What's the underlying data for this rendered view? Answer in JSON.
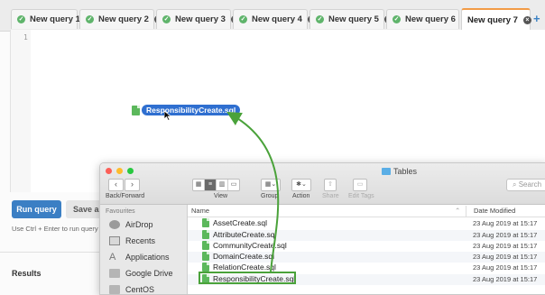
{
  "tabs": [
    {
      "label": "New query 1",
      "status": "check",
      "closable": false,
      "active": false
    },
    {
      "label": "New query 2",
      "status": "check",
      "closable": true,
      "active": false
    },
    {
      "label": "New query 3",
      "status": "check",
      "closable": true,
      "active": false
    },
    {
      "label": "New query 4",
      "status": "check",
      "closable": true,
      "active": false
    },
    {
      "label": "New query 5",
      "status": "check",
      "closable": true,
      "active": false
    },
    {
      "label": "New query 6",
      "status": "check",
      "closable": true,
      "active": false
    },
    {
      "label": "New query 7",
      "status": "none",
      "closable": true,
      "active": true
    }
  ],
  "add_tab_icon": "plus-icon",
  "editor": {
    "line_number": "1",
    "dragged_file": "ResponsibilityCreate.sql"
  },
  "actions": {
    "run_label": "Run query",
    "save_label": "Save as",
    "hint": "Use Ctrl + Enter to run query"
  },
  "results_label": "Results",
  "finder": {
    "title": "Tables",
    "toolbar": {
      "back_forward": "Back/Forward",
      "view": "View",
      "group": "Group",
      "action": "Action",
      "share": "Share",
      "edit_tags": "Edit Tags",
      "search_placeholder": "Search"
    },
    "sidebar": {
      "heading": "Favourites",
      "items": [
        "AirDrop",
        "Recents",
        "Applications",
        "Google Drive",
        "CentOS"
      ]
    },
    "columns": {
      "name": "Name",
      "date": "Date Modified"
    },
    "files": [
      {
        "name": "AssetCreate.sql",
        "date": "23 Aug 2019 at 15:17"
      },
      {
        "name": "AttributeCreate.sql",
        "date": "23 Aug 2019 at 15:17"
      },
      {
        "name": "CommunityCreate.sql",
        "date": "23 Aug 2019 at 15:17"
      },
      {
        "name": "DomainCreate.sql",
        "date": "23 Aug 2019 at 15:17"
      },
      {
        "name": "RelationCreate.sql",
        "date": "23 Aug 2019 at 15:17"
      },
      {
        "name": "ResponsibilityCreate.sql",
        "date": "23 Aug 2019 at 15:17"
      }
    ]
  },
  "colors": {
    "accent": "#3b7fc4",
    "active_tab_border": "#f29b46",
    "status_ok": "#5fb46b",
    "highlight": "#4aa23a",
    "selection": "#2f6fd0"
  }
}
